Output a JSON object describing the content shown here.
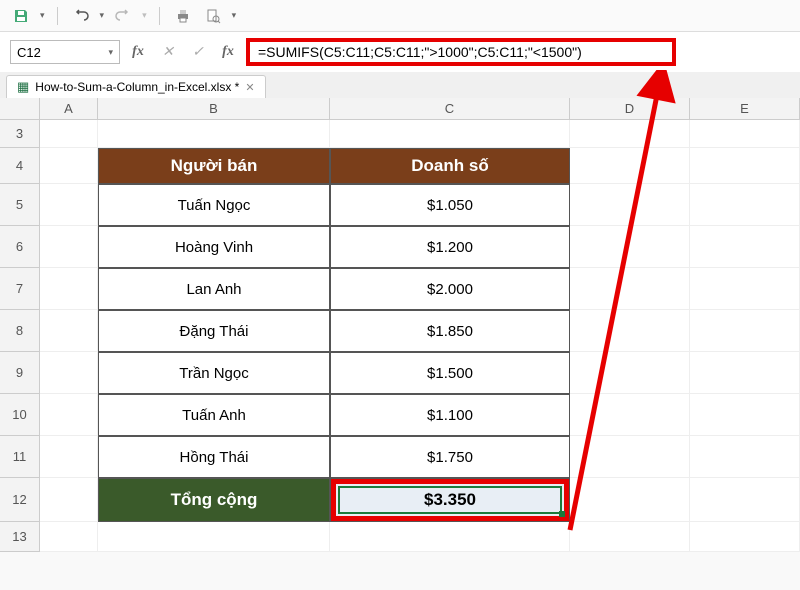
{
  "qat": {
    "save": "save-icon",
    "undo": "undo-icon",
    "redo": "redo-icon",
    "print": "print-icon",
    "preview": "print-preview-icon"
  },
  "nameBox": "C12",
  "formula": "=SUMIFS(C5:C11;C5:C11;\">1000\";C5:C11;\"<1500\")",
  "sheetTab": "How-to-Sum-a-Column_in-Excel.xlsx *",
  "columns": [
    "A",
    "B",
    "C",
    "D",
    "E"
  ],
  "rows": [
    "3",
    "4",
    "5",
    "6",
    "7",
    "8",
    "9",
    "10",
    "11",
    "12",
    "13"
  ],
  "headers": {
    "b": "Người bán",
    "c": "Doanh số"
  },
  "data": [
    {
      "name": "Tuấn Ngọc",
      "value": "$1.050"
    },
    {
      "name": "Hoàng Vinh",
      "value": "$1.200"
    },
    {
      "name": "Lan Anh",
      "value": "$2.000"
    },
    {
      "name": "Đặng Thái",
      "value": "$1.850"
    },
    {
      "name": "Trần Ngọc",
      "value": "$1.500"
    },
    {
      "name": "Tuấn Anh",
      "value": "$1.100"
    },
    {
      "name": "Hồng Thái",
      "value": "$1.750"
    }
  ],
  "total": {
    "label": "Tổng cộng",
    "value": "$3.350"
  }
}
